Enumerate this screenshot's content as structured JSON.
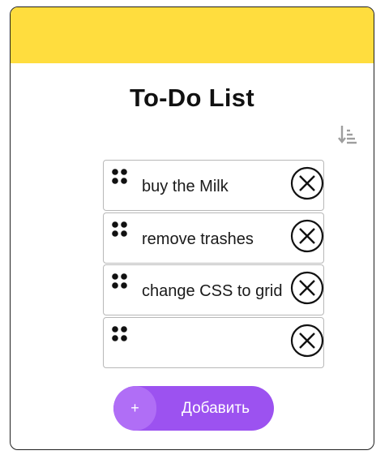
{
  "header": {
    "title": "To-Do List",
    "accent_color": "#ffdd3e"
  },
  "toolbar": {
    "sort_icon": "sort-descending-icon"
  },
  "todos": [
    {
      "text": "buy the Milk"
    },
    {
      "text": "remove trashes"
    },
    {
      "text": "change CSS to grid"
    },
    {
      "text": ""
    }
  ],
  "add_button": {
    "plus": "+",
    "label": "Добавить",
    "color": "#9c52f0"
  }
}
